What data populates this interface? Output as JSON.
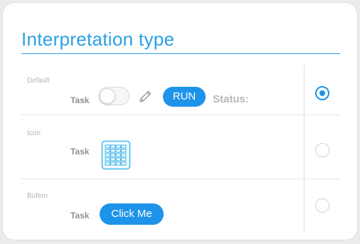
{
  "panel": {
    "title": "Interpretation type"
  },
  "options": [
    {
      "label": "Default",
      "task_label": "Task",
      "run_label": "RUN",
      "status_label": "Status:",
      "selected": true
    },
    {
      "label": "Icon",
      "task_label": "Task",
      "icon": "table-grid-icon",
      "selected": false
    },
    {
      "label": "Button",
      "task_label": "Task",
      "button_label": "Click Me",
      "selected": false
    }
  ],
  "colors": {
    "accent": "#1e93ea",
    "title": "#2aa0e6",
    "muted_text": "#b5b5b5"
  }
}
